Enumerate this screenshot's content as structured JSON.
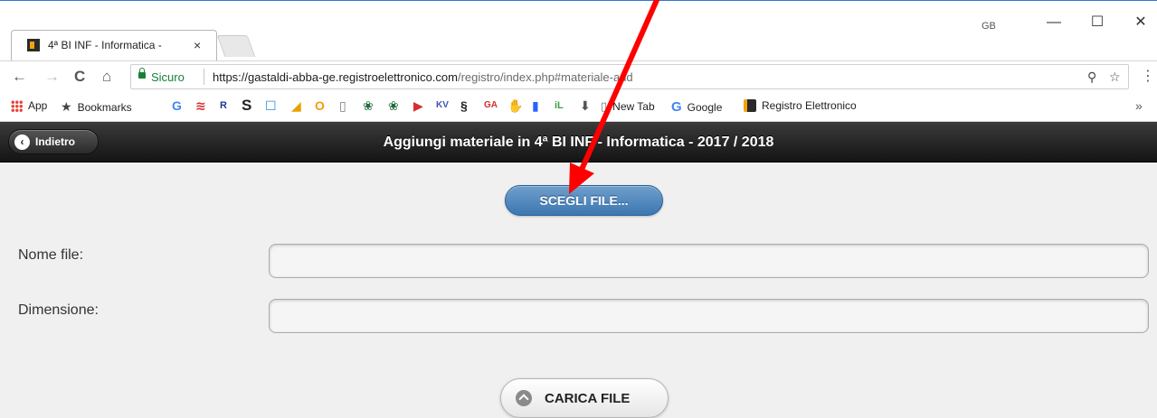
{
  "browser": {
    "tab_title": "4ª BI INF - Informatica - ",
    "tab_close": "×",
    "profile": "GB",
    "window": {
      "minimize": "—",
      "maximize": "☐",
      "close": "✕"
    },
    "nav": {
      "back": "←",
      "forward": "→",
      "reload": "C",
      "home": "⌂"
    },
    "omnibox": {
      "secure_label": "Sicuro",
      "url_host": "https://gastaldi-abba-ge.registroelettronico.com",
      "url_path": "/registro/index.php#materiale-add",
      "key_icon": "key-icon",
      "star_icon": "star-icon"
    },
    "menu": "⋮",
    "bookmarks": [
      {
        "label": "App",
        "icon": "apps-grid-icon",
        "color": "#e94235"
      },
      {
        "label": "Bookmarks",
        "icon": "star-icon",
        "color": "#444444"
      },
      {
        "label": "New Tab",
        "icon": "page-icon",
        "color": "#777777"
      },
      {
        "label": "Google",
        "icon": "google-icon",
        "color": "#4285f4"
      },
      {
        "label": "Registro Elettronico",
        "icon": "registro-icon",
        "color": "#2a2a2a"
      }
    ],
    "bookmark_glyphs": [
      "G",
      "≋",
      "R",
      "S",
      "☐",
      "◢",
      "O",
      "▯",
      "❀",
      "❀",
      "▶",
      "KV",
      "§",
      "GA",
      "✋",
      "▮",
      "iL",
      "⬇"
    ],
    "bookmarks_overflow": "»"
  },
  "header": {
    "back_label": "Indietro",
    "title": "Aggiungi materiale in 4ª BI INF - Informatica - 2017 / 2018"
  },
  "form": {
    "choose_file_label": "SCEGLI FILE...",
    "file_name_label": "Nome file:",
    "file_name_value": "",
    "size_label": "Dimensione:",
    "size_value": "",
    "upload_label": "CARICA FILE"
  },
  "colors": {
    "accent_blue": "#3c77b1",
    "annotation_arrow": "#ff0000",
    "header_dark": "#141414"
  }
}
